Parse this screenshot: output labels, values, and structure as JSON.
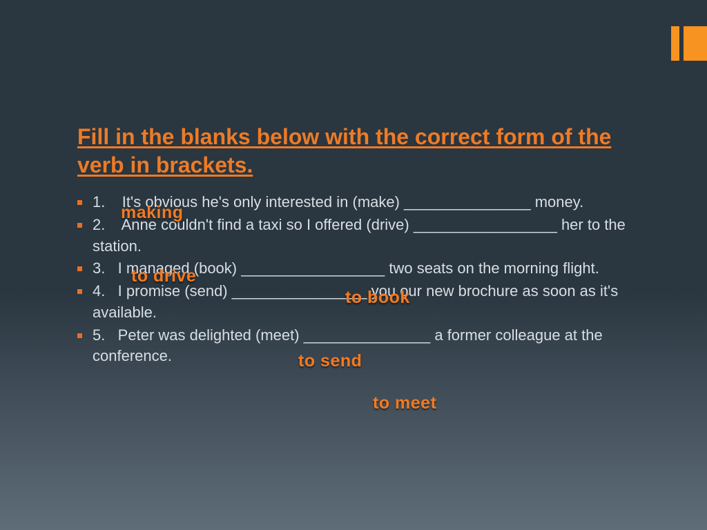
{
  "title": "Fill in the blanks below with the correct form of the verb in brackets.",
  "items": [
    "1.    It's obvious he's only interested in (make) _______________ money.",
    "2.    Anne couldn't find a taxi so I offered (drive) _________________ her to the station.",
    "3.   I managed (book) _________________ two seats on the morning flight.",
    "4.   I promise (send) ________________ you our new brochure as soon as it's available.",
    "5.   Peter was delighted (meet) _______________ a former colleague at the conference."
  ],
  "answers": [
    "making",
    "to drive",
    "to book",
    "to send",
    "to meet"
  ],
  "accent": "#f79321"
}
